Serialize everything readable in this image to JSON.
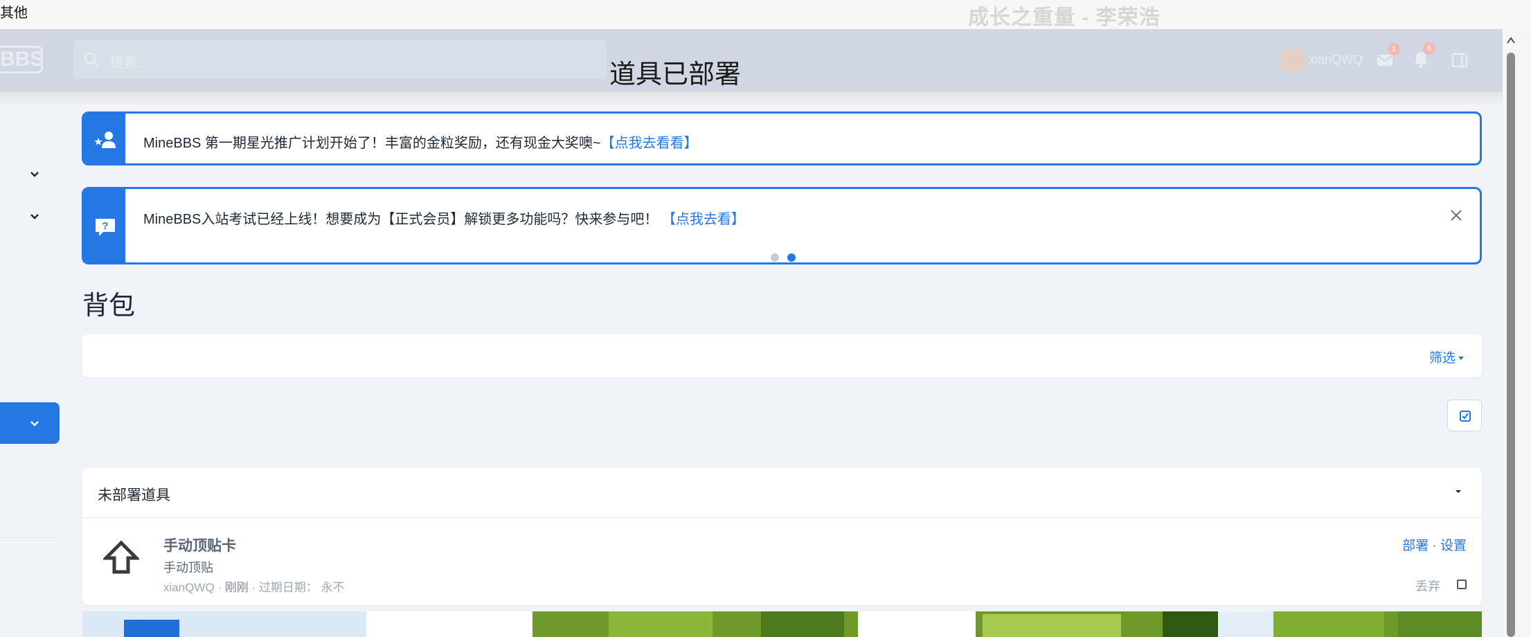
{
  "topbar": {
    "left_text": "其他",
    "music_title": "成长之重量 - 李荣浩"
  },
  "header": {
    "logo_text": "BBS",
    "search_placeholder": "搜索...",
    "toast_text": "道具已部署",
    "username": "xianQWQ",
    "mail_badge": "1",
    "alert_badge": "6"
  },
  "notices": [
    {
      "text": "MineBBS 第一期星光推广计划开始了！丰富的金粒奖励，还有现金大奖噢~",
      "link": "【点我去看看】",
      "icon": "user-star-icon"
    },
    {
      "text": "MineBBS入站考试已经上线！想要成为【正式会员】解锁更多功能吗？快来参与吧！",
      "link": "【点我去看】",
      "icon": "question-bubble-icon"
    }
  ],
  "page": {
    "title": "背包",
    "filter_label": "筛选"
  },
  "block": {
    "title": "未部署道具",
    "item": {
      "name": "手动顶贴卡",
      "description": "手动顶贴",
      "owner": "xianQWQ",
      "time": "刚刚",
      "expire_label": "过期日期：",
      "expire_value": "永不",
      "deploy_label": "部署",
      "settings_label": "设置",
      "discard_label": "丢弃"
    }
  },
  "colors": {
    "accent": "#2577e3",
    "header_bg": "#d0d7e2",
    "page_bg": "#f0f4f9"
  }
}
